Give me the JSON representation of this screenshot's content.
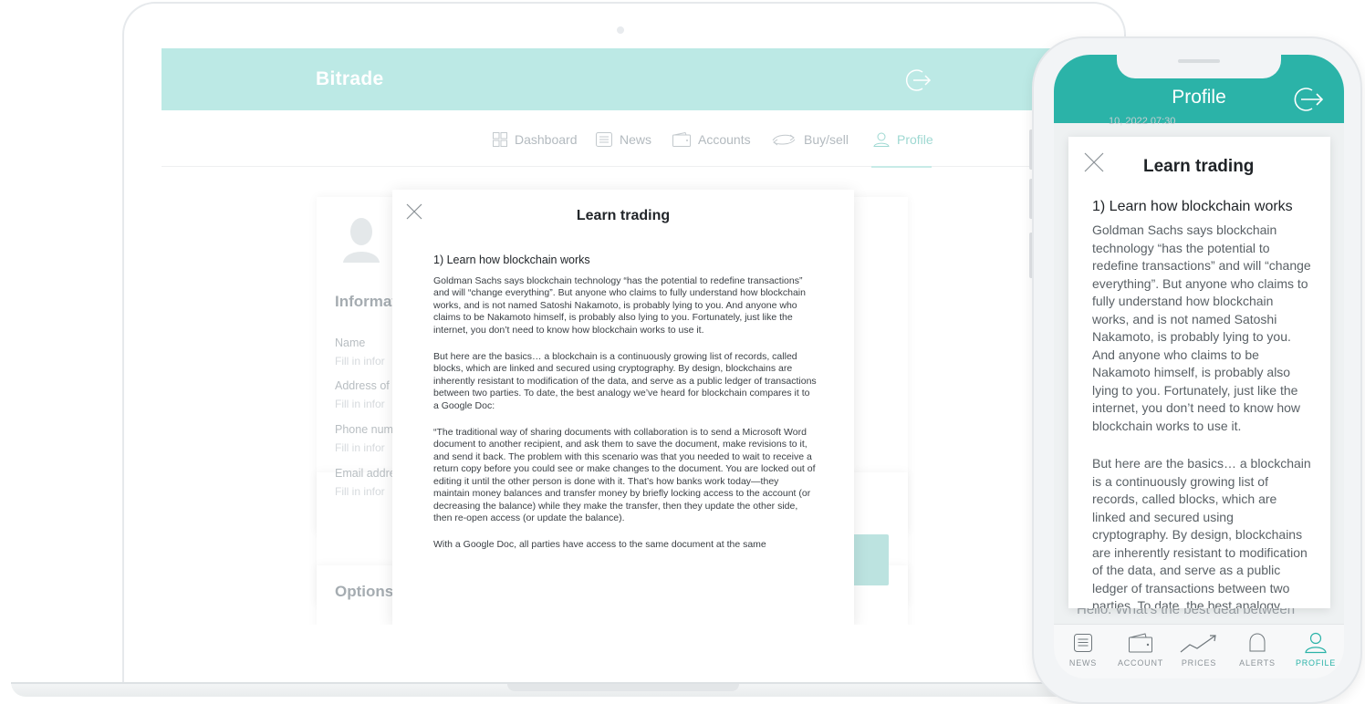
{
  "desktop": {
    "logo": "Bitrade",
    "nav": [
      {
        "label": "Dashboard",
        "icon": "dashboard-icon"
      },
      {
        "label": "News",
        "icon": "news-icon"
      },
      {
        "label": "Accounts",
        "icon": "wallet-icon"
      },
      {
        "label": "Buy/sell",
        "icon": "exchange-icon"
      },
      {
        "label": "Profile",
        "icon": "user-icon",
        "active": true
      }
    ],
    "profile": {
      "information_title": "Informat",
      "fields": [
        {
          "label": "Name",
          "hint": "Fill in infor"
        },
        {
          "label": "Address of",
          "hint": "Fill in infor"
        },
        {
          "label": "Phone num",
          "hint": "Fill in infor"
        },
        {
          "label": "Email addre",
          "hint": "Fill in infor"
        }
      ],
      "options_title": "Options"
    },
    "modal": {
      "title": "Learn trading",
      "heading": "1) Learn how blockchain works",
      "paragraphs": [
        "Goldman Sachs says blockchain technology “has the potential to redefine transactions” and will “change everything”. But anyone who claims to fully understand how blockchain works, and is not named Satoshi Nakamoto, is probably lying to you. And anyone who claims to be Nakamoto himself, is probably also lying to you. Fortunately, just like the internet, you don’t need to know how blockchain works to use it.",
        "But here are the basics… a blockchain is a continuously growing list of records, called blocks, which are linked and secured using cryptography. By design, blockchains are inherently resistant to modification of the data, and serve as a public ledger of transactions between two parties. To date, the best analogy we’ve heard for blockchain compares it to a Google Doc:",
        "“The traditional way of sharing documents with collaboration is to send a Microsoft Word document to another recipient, and ask them to save the document, make revisions to it, and send it back. The problem with this scenario was that you needed to wait to receive a return copy before you could see or make changes to the document. You are locked out of editing it until the other person is done with it. That’s how banks work today—they maintain money balances and transfer money by briefly locking access to the account (or decreasing the balance) while they make the transfer, then they update the other side, then re-open access (or update the balance).",
        "With a Google Doc, all parties have access to the same document at the same"
      ]
    }
  },
  "mobile": {
    "title": "Profile",
    "behind_top": "10, 2022 07:30",
    "behind_bottom": "Hello. What’s the best deal between",
    "modal": {
      "title": "Learn trading",
      "heading": "1) Learn how blockchain works",
      "paragraphs": [
        "Goldman Sachs says blockchain technology “has the potential to redefine transactions” and will “change everything”. But anyone who claims to fully understand how blockchain works, and is not named Satoshi Nakamoto, is probably lying to you. And anyone who claims to be Nakamoto himself, is probably also lying to you. Fortunately, just like the internet, you don’t need to know how blockchain works to use it.",
        "But here are the basics… a blockchain is a continuously growing list of records, called blocks, which are linked and secured using cryptography. By design, blockchains are inherently resistant to modification of the data, and serve as a public ledger of transactions between two parties. To date, the best analogy we’ve heard for blockchain compares it to a Google Doc:"
      ]
    },
    "tabs": [
      {
        "label": "NEWS",
        "icon": "news-icon"
      },
      {
        "label": "ACCOUNT",
        "icon": "wallet-icon"
      },
      {
        "label": "PRICES",
        "icon": "trend-icon"
      },
      {
        "label": "ALERTS",
        "icon": "bell-icon"
      },
      {
        "label": "PROFILE",
        "icon": "user-icon",
        "active": true
      }
    ]
  },
  "colors": {
    "header_desktop": "#bce9e5",
    "header_mobile": "#2bb3a8",
    "accent": "#2bb3a8"
  }
}
